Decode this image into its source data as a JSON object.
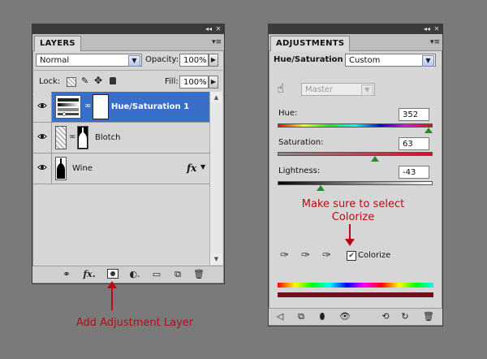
{
  "layers_panel": {
    "tab": "LAYERS",
    "blend_mode": "Normal",
    "opacity_label": "Opacity:",
    "opacity_value": "100%",
    "lock_label": "Lock:",
    "fill_label": "Fill:",
    "fill_value": "100%",
    "fx_symbol": "fx",
    "layers": [
      {
        "name": "Hue/Saturation 1",
        "selected": true
      },
      {
        "name": "Blotch",
        "selected": false
      },
      {
        "name": "Wine",
        "selected": false
      }
    ]
  },
  "adjustments_panel": {
    "tab": "ADJUSTMENTS",
    "title": "Hue/Saturation",
    "preset": "Custom",
    "channel": "Master",
    "hue_label": "Hue:",
    "hue_value": "352",
    "saturation_label": "Saturation:",
    "saturation_value": "63",
    "lightness_label": "Lightness:",
    "lightness_value": "-43",
    "colorize_label": "Colorize",
    "colorize_checked": true,
    "slider_positions": {
      "hue": 0.978,
      "saturation": 0.63,
      "lightness": 0.285
    }
  },
  "annotations": {
    "adjustments_note_line1": "Make sure to select",
    "adjustments_note_line2": "Colorize",
    "layers_note": "Add Adjustment Layer"
  },
  "colors": {
    "selection": "#3a6fc9",
    "annotation": "#b40c14",
    "panel_bg": "#d6d6d6"
  }
}
